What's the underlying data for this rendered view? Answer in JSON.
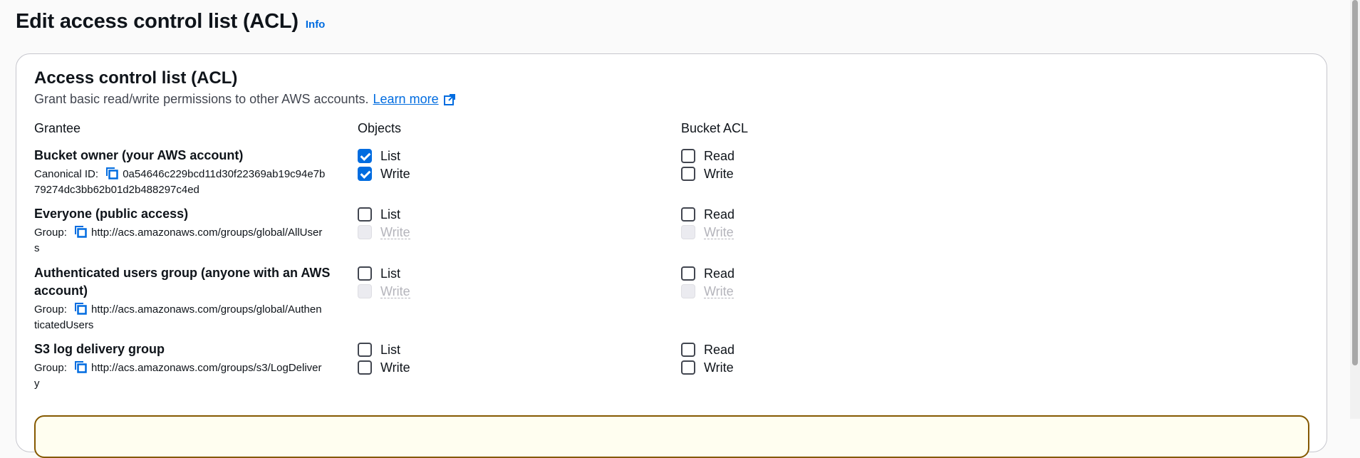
{
  "page": {
    "title": "Edit access control list (ACL)",
    "info": "Info"
  },
  "panel": {
    "title": "Access control list (ACL)",
    "description": "Grant basic read/write permissions to other AWS accounts.",
    "learn_more": "Learn more"
  },
  "columns": {
    "grantee": "Grantee",
    "objects": "Objects",
    "bucket_acl": "Bucket ACL"
  },
  "grantees": [
    {
      "name": "Bucket owner (your AWS account)",
      "id_label": "Canonical ID:",
      "id_line1": "0a54646c229bcd11d30f22369ab19c94e7b",
      "id_line2": "79274dc3bb62b01d2b488297c4ed",
      "objects_list": "List",
      "objects_write": "Write",
      "acl_read": "Read",
      "acl_write": "Write"
    },
    {
      "name": "Everyone (public access)",
      "id_label": "Group:",
      "id_line1": "http://acs.amazonaws.com/groups/global/AllUser",
      "id_line2": "s",
      "objects_list": "List",
      "objects_write": "Write",
      "acl_read": "Read",
      "acl_write": "Write"
    },
    {
      "name_line1": "Authenticated users group (anyone with an AWS",
      "name_line2": "account)",
      "id_label": "Group:",
      "id_line1": "http://acs.amazonaws.com/groups/global/Authen",
      "id_line2": "ticatedUsers",
      "objects_list": "List",
      "objects_write": "Write",
      "acl_read": "Read",
      "acl_write": "Write"
    },
    {
      "name": "S3 log delivery group",
      "id_label": "Group:",
      "id_line1": "http://acs.amazonaws.com/groups/s3/LogDeliver",
      "id_line2": "y",
      "objects_list": "List",
      "objects_write": "Write",
      "acl_read": "Read",
      "acl_write": "Write"
    }
  ],
  "state": {
    "owner_objects_list": true,
    "owner_objects_write": true,
    "owner_acl_read": false,
    "owner_acl_write": false,
    "everyone_objects_write_disabled": true,
    "everyone_acl_write_disabled": true,
    "auth_objects_write_disabled": true,
    "auth_acl_write_disabled": true
  },
  "icons": {
    "external_link": "external-link-icon",
    "copy": "copy-icon"
  },
  "colors": {
    "link": "#006ce0",
    "checkbox_checked": "#006ce0",
    "warning_border": "#855900"
  }
}
